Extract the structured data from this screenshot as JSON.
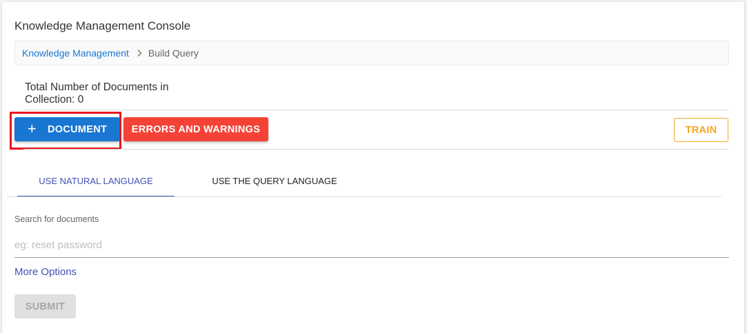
{
  "page": {
    "title": "Knowledge Management Console"
  },
  "breadcrumb": {
    "root": "Knowledge Management",
    "current": "Build Query"
  },
  "collection": {
    "document_count_text": "Total Number of Documents in Collection: 0"
  },
  "toolbar": {
    "add_document_plus": "+",
    "add_document_label": "DOCUMENT",
    "errors_label": "ERRORS AND WARNINGS",
    "train_label": "TRAIN"
  },
  "tabs": [
    {
      "label": "USE NATURAL LANGUAGE",
      "active": true
    },
    {
      "label": "USE THE QUERY LANGUAGE",
      "active": false
    }
  ],
  "search": {
    "label": "Search for documents",
    "placeholder": "eg: reset password",
    "value": ""
  },
  "more_options_label": "More Options",
  "submit_label": "SUBMIT",
  "icons": {
    "breadcrumb_separator": "chevron-right-icon",
    "add": "plus-icon"
  },
  "colors": {
    "primary": "#1976d2",
    "danger": "#f44336",
    "warning": "#f5a623",
    "tab_active": "#3f51b5",
    "highlight": "#e8151b"
  }
}
